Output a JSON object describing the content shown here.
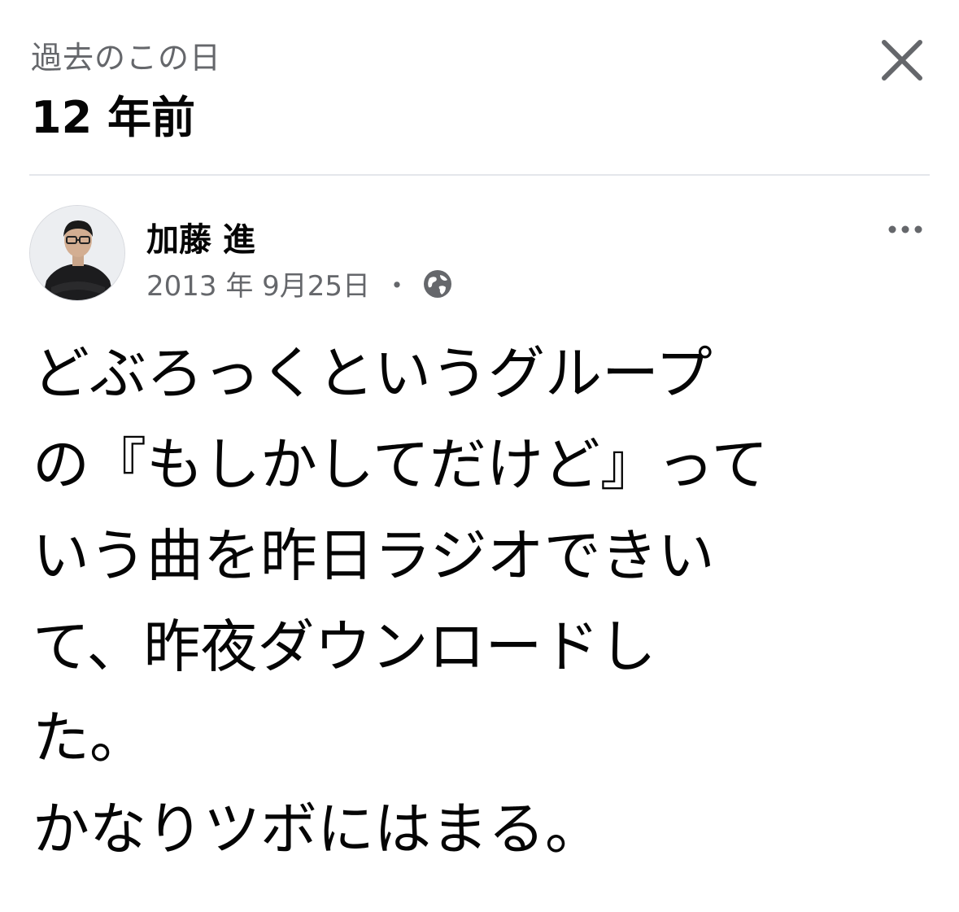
{
  "header": {
    "subtitle": "過去のこの日",
    "title": "12 年前"
  },
  "post": {
    "author": "加藤 進",
    "date": "2013 年 9月25日",
    "separator": "・",
    "privacy_icon": "globe-icon",
    "lines": [
      "どぶろっくというグループ",
      "の『もしかしてだけど』って",
      "いう曲を昨日ラジオできい",
      "て、昨夜ダウンロードし",
      "た。",
      "かなりツボにはまる。"
    ]
  },
  "colors": {
    "primary_text": "#050505",
    "secondary_text": "#65676b",
    "divider": "#e4e6eb",
    "icon": "#65676b"
  }
}
